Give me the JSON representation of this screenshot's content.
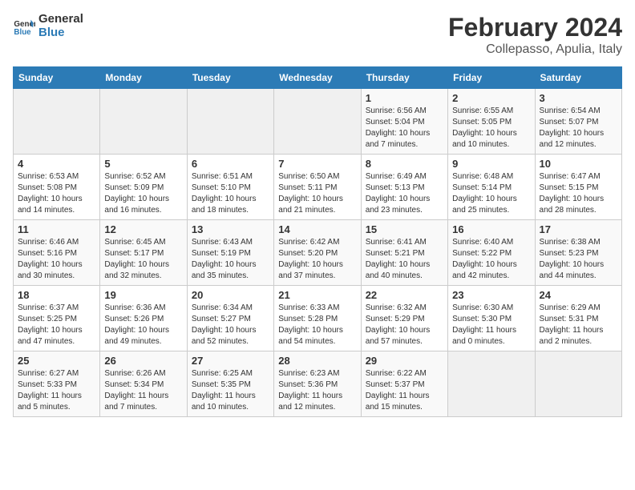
{
  "header": {
    "logo_line1": "General",
    "logo_line2": "Blue",
    "title": "February 2024",
    "subtitle": "Collepasso, Apulia, Italy"
  },
  "columns": [
    "Sunday",
    "Monday",
    "Tuesday",
    "Wednesday",
    "Thursday",
    "Friday",
    "Saturday"
  ],
  "weeks": [
    [
      {
        "day": "",
        "sunrise": "",
        "sunset": "",
        "daylight": "",
        "empty": true
      },
      {
        "day": "",
        "sunrise": "",
        "sunset": "",
        "daylight": "",
        "empty": true
      },
      {
        "day": "",
        "sunrise": "",
        "sunset": "",
        "daylight": "",
        "empty": true
      },
      {
        "day": "",
        "sunrise": "",
        "sunset": "",
        "daylight": "",
        "empty": true
      },
      {
        "day": "1",
        "sunrise": "6:56 AM",
        "sunset": "5:04 PM",
        "daylight": "10 hours and 7 minutes."
      },
      {
        "day": "2",
        "sunrise": "6:55 AM",
        "sunset": "5:05 PM",
        "daylight": "10 hours and 10 minutes."
      },
      {
        "day": "3",
        "sunrise": "6:54 AM",
        "sunset": "5:07 PM",
        "daylight": "10 hours and 12 minutes."
      }
    ],
    [
      {
        "day": "4",
        "sunrise": "6:53 AM",
        "sunset": "5:08 PM",
        "daylight": "10 hours and 14 minutes."
      },
      {
        "day": "5",
        "sunrise": "6:52 AM",
        "sunset": "5:09 PM",
        "daylight": "10 hours and 16 minutes."
      },
      {
        "day": "6",
        "sunrise": "6:51 AM",
        "sunset": "5:10 PM",
        "daylight": "10 hours and 18 minutes."
      },
      {
        "day": "7",
        "sunrise": "6:50 AM",
        "sunset": "5:11 PM",
        "daylight": "10 hours and 21 minutes."
      },
      {
        "day": "8",
        "sunrise": "6:49 AM",
        "sunset": "5:13 PM",
        "daylight": "10 hours and 23 minutes."
      },
      {
        "day": "9",
        "sunrise": "6:48 AM",
        "sunset": "5:14 PM",
        "daylight": "10 hours and 25 minutes."
      },
      {
        "day": "10",
        "sunrise": "6:47 AM",
        "sunset": "5:15 PM",
        "daylight": "10 hours and 28 minutes."
      }
    ],
    [
      {
        "day": "11",
        "sunrise": "6:46 AM",
        "sunset": "5:16 PM",
        "daylight": "10 hours and 30 minutes."
      },
      {
        "day": "12",
        "sunrise": "6:45 AM",
        "sunset": "5:17 PM",
        "daylight": "10 hours and 32 minutes."
      },
      {
        "day": "13",
        "sunrise": "6:43 AM",
        "sunset": "5:19 PM",
        "daylight": "10 hours and 35 minutes."
      },
      {
        "day": "14",
        "sunrise": "6:42 AM",
        "sunset": "5:20 PM",
        "daylight": "10 hours and 37 minutes."
      },
      {
        "day": "15",
        "sunrise": "6:41 AM",
        "sunset": "5:21 PM",
        "daylight": "10 hours and 40 minutes."
      },
      {
        "day": "16",
        "sunrise": "6:40 AM",
        "sunset": "5:22 PM",
        "daylight": "10 hours and 42 minutes."
      },
      {
        "day": "17",
        "sunrise": "6:38 AM",
        "sunset": "5:23 PM",
        "daylight": "10 hours and 44 minutes."
      }
    ],
    [
      {
        "day": "18",
        "sunrise": "6:37 AM",
        "sunset": "5:25 PM",
        "daylight": "10 hours and 47 minutes."
      },
      {
        "day": "19",
        "sunrise": "6:36 AM",
        "sunset": "5:26 PM",
        "daylight": "10 hours and 49 minutes."
      },
      {
        "day": "20",
        "sunrise": "6:34 AM",
        "sunset": "5:27 PM",
        "daylight": "10 hours and 52 minutes."
      },
      {
        "day": "21",
        "sunrise": "6:33 AM",
        "sunset": "5:28 PM",
        "daylight": "10 hours and 54 minutes."
      },
      {
        "day": "22",
        "sunrise": "6:32 AM",
        "sunset": "5:29 PM",
        "daylight": "10 hours and 57 minutes."
      },
      {
        "day": "23",
        "sunrise": "6:30 AM",
        "sunset": "5:30 PM",
        "daylight": "11 hours and 0 minutes."
      },
      {
        "day": "24",
        "sunrise": "6:29 AM",
        "sunset": "5:31 PM",
        "daylight": "11 hours and 2 minutes."
      }
    ],
    [
      {
        "day": "25",
        "sunrise": "6:27 AM",
        "sunset": "5:33 PM",
        "daylight": "11 hours and 5 minutes."
      },
      {
        "day": "26",
        "sunrise": "6:26 AM",
        "sunset": "5:34 PM",
        "daylight": "11 hours and 7 minutes."
      },
      {
        "day": "27",
        "sunrise": "6:25 AM",
        "sunset": "5:35 PM",
        "daylight": "11 hours and 10 minutes."
      },
      {
        "day": "28",
        "sunrise": "6:23 AM",
        "sunset": "5:36 PM",
        "daylight": "11 hours and 12 minutes."
      },
      {
        "day": "29",
        "sunrise": "6:22 AM",
        "sunset": "5:37 PM",
        "daylight": "11 hours and 15 minutes."
      },
      {
        "day": "",
        "sunrise": "",
        "sunset": "",
        "daylight": "",
        "empty": true
      },
      {
        "day": "",
        "sunrise": "",
        "sunset": "",
        "daylight": "",
        "empty": true
      }
    ]
  ],
  "labels": {
    "sunrise": "Sunrise: ",
    "sunset": "Sunset: ",
    "daylight": "Daylight: "
  }
}
